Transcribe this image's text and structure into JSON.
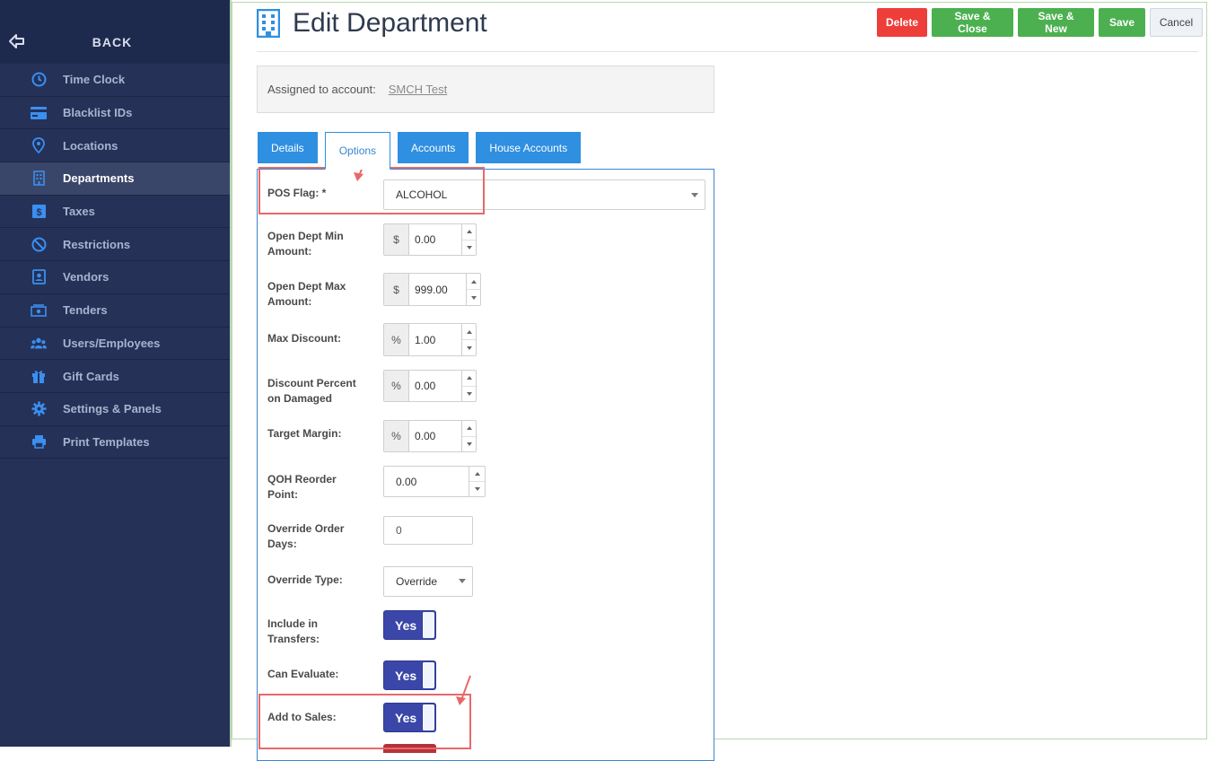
{
  "sidebar": {
    "back_label": "BACK",
    "items": [
      {
        "label": "Time Clock",
        "icon": "clock-icon",
        "active": false
      },
      {
        "label": "Blacklist IDs",
        "icon": "card-icon",
        "active": false
      },
      {
        "label": "Locations",
        "icon": "map-pin-icon",
        "active": false
      },
      {
        "label": "Departments",
        "icon": "building-icon",
        "active": true
      },
      {
        "label": "Taxes",
        "icon": "dollar-icon",
        "active": false
      },
      {
        "label": "Restrictions",
        "icon": "ban-icon",
        "active": false
      },
      {
        "label": "Vendors",
        "icon": "contact-icon",
        "active": false
      },
      {
        "label": "Tenders",
        "icon": "money-icon",
        "active": false
      },
      {
        "label": "Users/Employees",
        "icon": "users-icon",
        "active": false
      },
      {
        "label": "Gift Cards",
        "icon": "gift-icon",
        "active": false
      },
      {
        "label": "Settings & Panels",
        "icon": "gear-icon",
        "active": false
      },
      {
        "label": "Print Templates",
        "icon": "printer-icon",
        "active": false
      }
    ]
  },
  "header": {
    "title": "Edit Department",
    "buttons": {
      "delete": "Delete",
      "save_close": "Save & Close",
      "save_new": "Save & New",
      "save": "Save",
      "cancel": "Cancel"
    }
  },
  "assigned": {
    "label": "Assigned to account:",
    "account": "SMCH Test"
  },
  "tabs": [
    "Details",
    "Options",
    "Accounts",
    "House Accounts"
  ],
  "active_tab": "Options",
  "form": {
    "pos_flag": {
      "label": "POS Flag: *",
      "value": "ALCOHOL"
    },
    "open_min": {
      "label1": "Open Dept Min",
      "label2": "Amount:",
      "addon": "$",
      "value": "0.00"
    },
    "open_max": {
      "label1": "Open Dept Max",
      "label2": "Amount:",
      "addon": "$",
      "value": "999.00"
    },
    "max_discount": {
      "label": "Max Discount:",
      "addon": "%",
      "value": "1.00"
    },
    "discount_damaged": {
      "label1": "Discount Percent",
      "label2": "on Damaged",
      "addon": "%",
      "value": "0.00"
    },
    "target_margin": {
      "label": "Target Margin:",
      "addon": "%",
      "value": "0.00"
    },
    "qoh_reorder": {
      "label1": "QOH Reorder",
      "label2": "Point:",
      "value": "0.00"
    },
    "override_days": {
      "label1": "Override Order",
      "label2": "Days:",
      "value": "0"
    },
    "override_type": {
      "label": "Override Type:",
      "value": "Override"
    },
    "include_transfers": {
      "label1": "Include in",
      "label2": "Transfers:",
      "value": "Yes"
    },
    "can_evaluate": {
      "label": "Can Evaluate:",
      "value": "Yes"
    },
    "add_to_sales": {
      "label": "Add to Sales:",
      "value": "Yes"
    }
  },
  "colors": {
    "sidebar_bg": "#253157",
    "accent_blue": "#2f8fe0",
    "delete_red": "#ee3e3a",
    "save_green": "#4cb050",
    "toggle_blue": "#3a46a8",
    "annotation_red": "#e8686a"
  }
}
